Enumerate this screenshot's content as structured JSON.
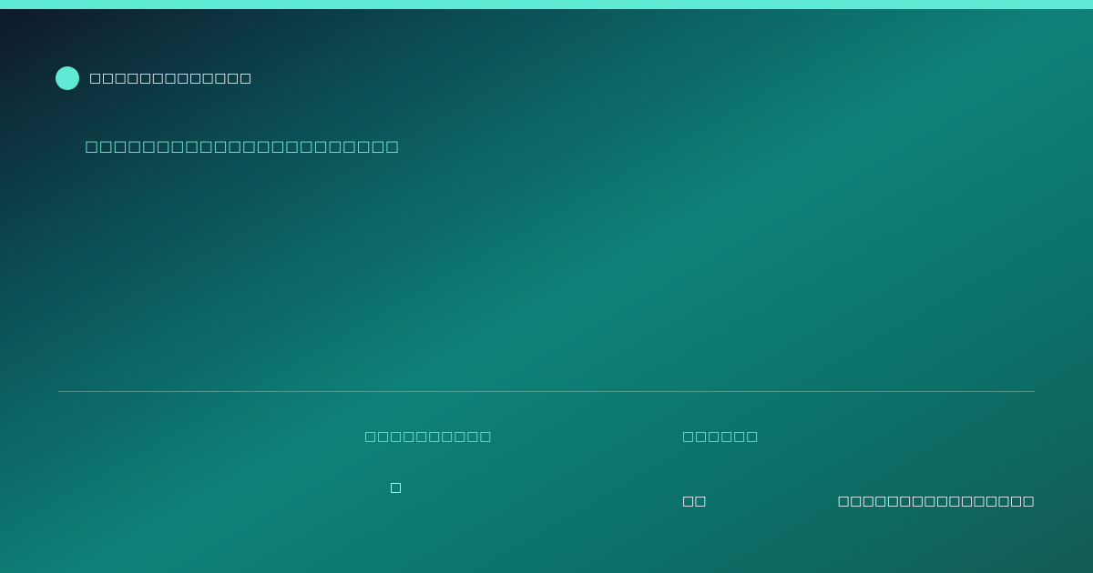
{
  "header": {
    "brand_name": "□□□□□□□□□□□□□"
  },
  "hero": {
    "tagline": "□□□□□□□□□□□□□□□□□□□□□□"
  },
  "stats": [
    {
      "label": "□□□□□□□□□□",
      "value": "□"
    },
    {
      "label": "□□□□□□",
      "value": "□□"
    }
  ],
  "footer": {
    "url": "□□□□□□□□□□□□□□□□"
  },
  "colors": {
    "accent": "#5eead4",
    "teal": "#0e8278",
    "dark": "#0f172a"
  }
}
